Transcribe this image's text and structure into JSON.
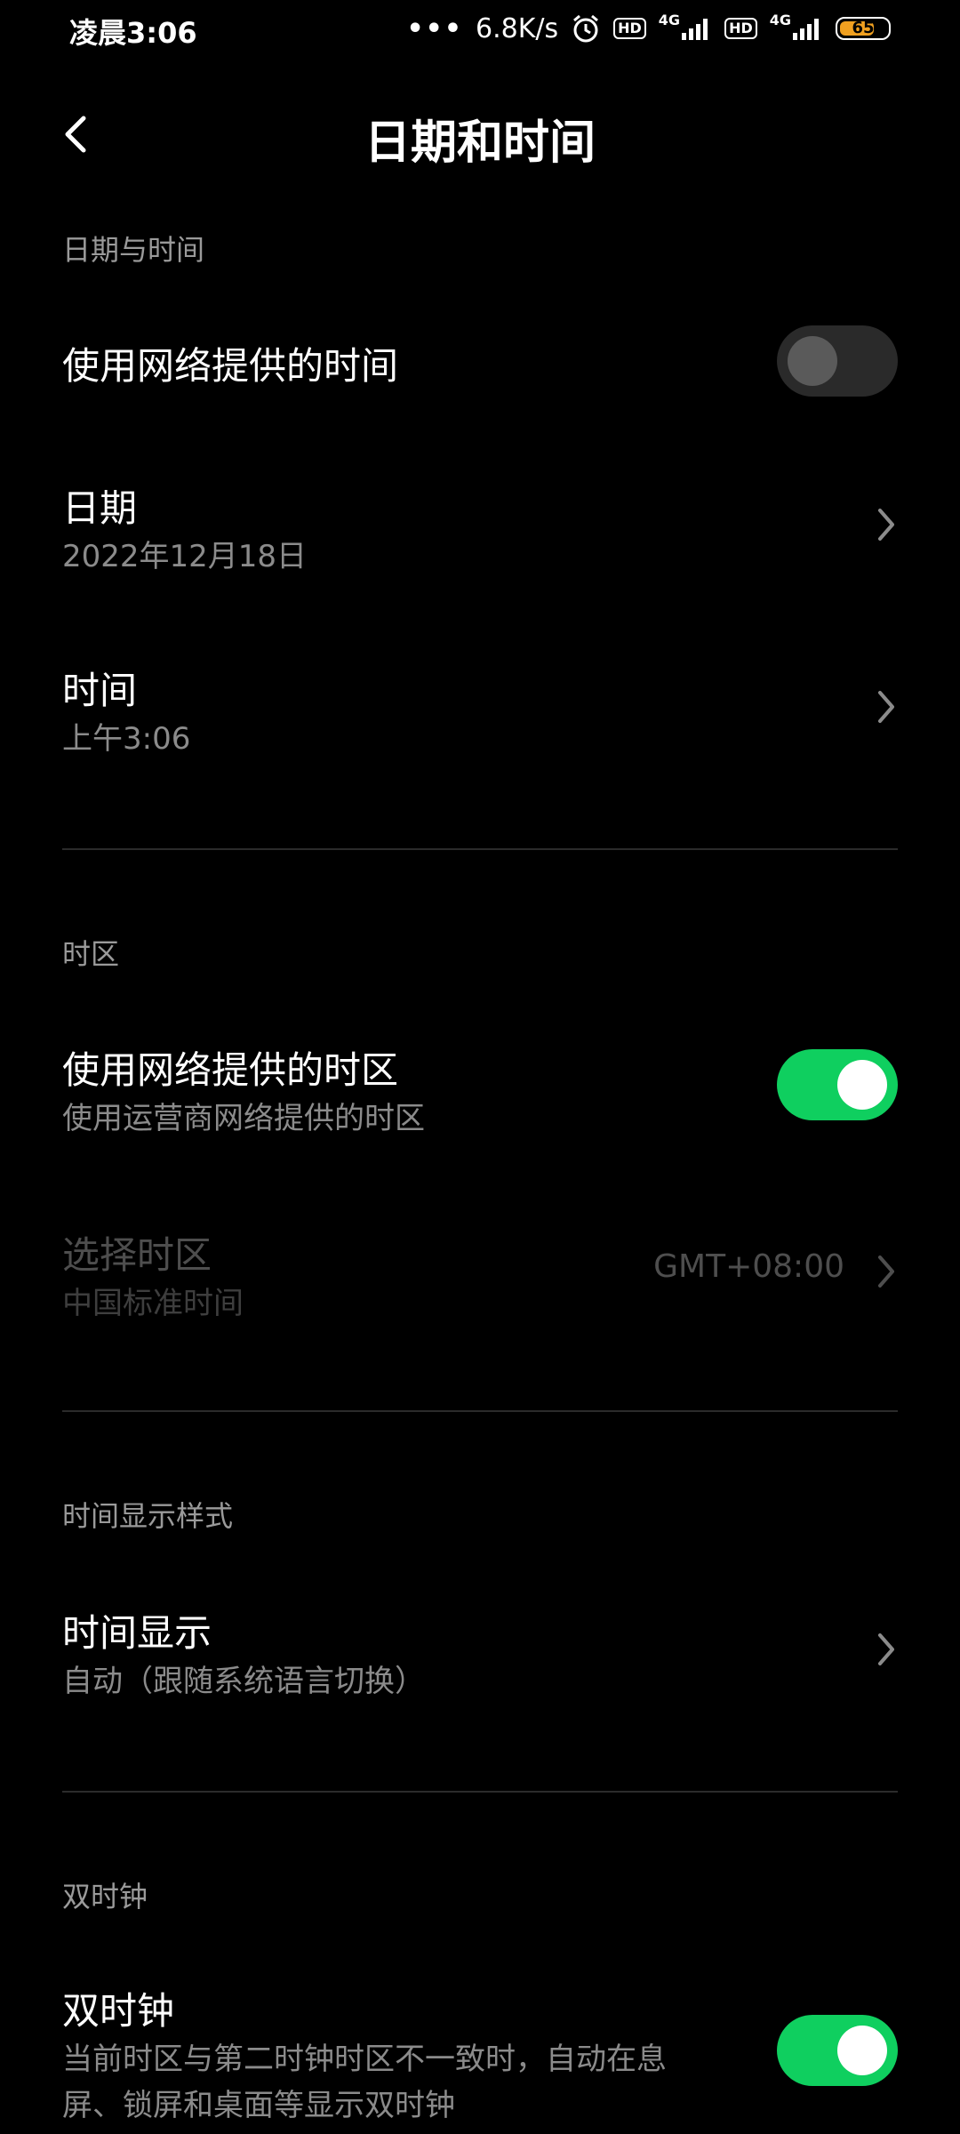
{
  "status_bar": {
    "time": "凌晨3:06",
    "net_speed": "6.8K/s",
    "hd1": "HD",
    "net1": "4G",
    "hd2": "HD",
    "net2": "4G",
    "battery": "65"
  },
  "header": {
    "title": "日期和时间"
  },
  "sections": {
    "date_time": {
      "title": "日期与时间",
      "network_time_label": "使用网络提供的时间",
      "network_time_on": false,
      "date_label": "日期",
      "date_value": "2022年12月18日",
      "time_label": "时间",
      "time_value": "上午3:06"
    },
    "timezone": {
      "title": "时区",
      "network_tz_label": "使用网络提供的时区",
      "network_tz_sub": "使用运营商网络提供的时区",
      "network_tz_on": true,
      "select_tz_label": "选择时区",
      "select_tz_sub": "中国标准时间",
      "select_tz_value": "GMT+08:00"
    },
    "display": {
      "title": "时间显示样式",
      "time_display_label": "时间显示",
      "time_display_value": "自动（跟随系统语言切换）"
    },
    "dual_clock": {
      "title": "双时钟",
      "label": "双时钟",
      "desc_line1": "当前时区与第二时钟时区不一致时，自动在息",
      "desc_line2": "屏、锁屏和桌面等显示双时钟",
      "on": true
    }
  },
  "colors": {
    "accent_on": "#0fcf5f",
    "toggle_off": "#2a2a2a",
    "battery": "#f0a020"
  }
}
